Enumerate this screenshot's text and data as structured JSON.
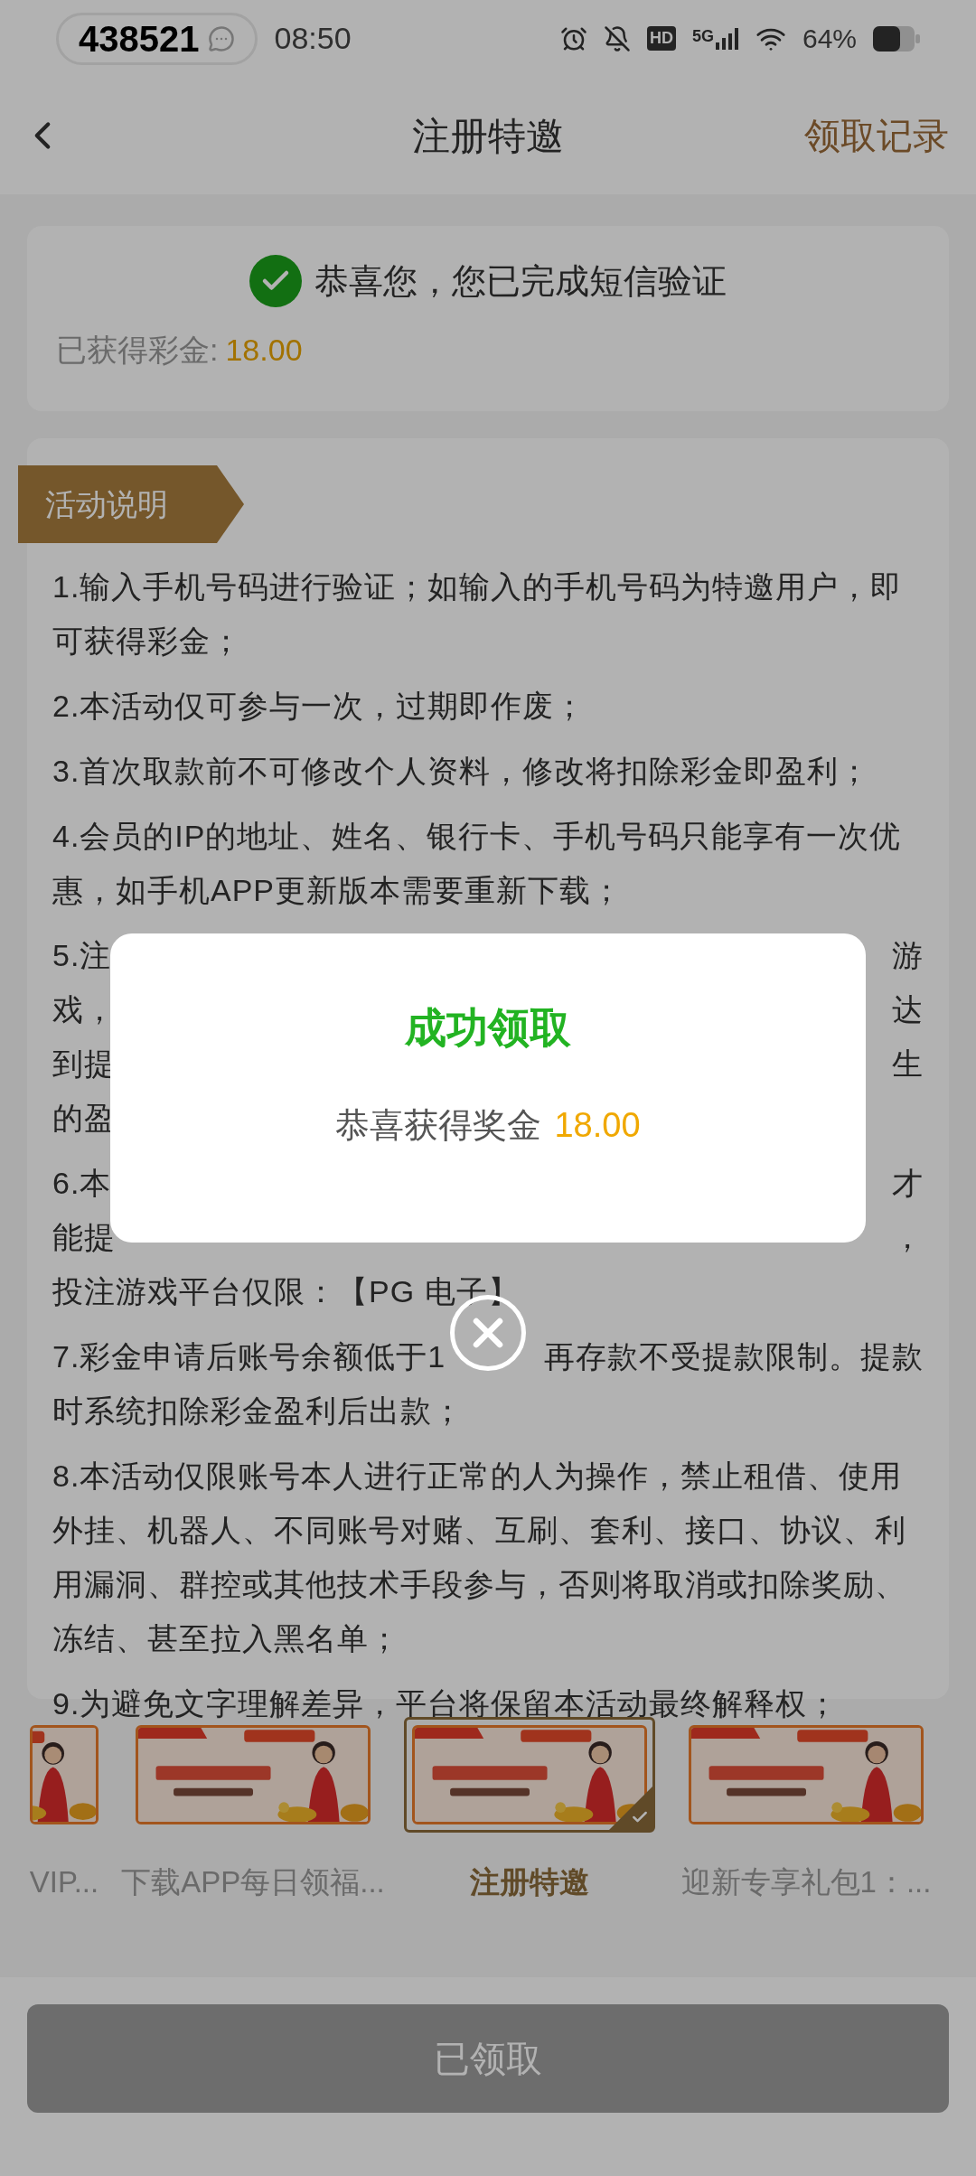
{
  "status_bar": {
    "badge": "438521",
    "time": "08:50",
    "hd": "HD",
    "network": "5G",
    "battery": "64%"
  },
  "header": {
    "title": "注册特邀",
    "action": "领取记录"
  },
  "verify_card": {
    "message": "恭喜您，您已完成短信验证",
    "earned_label": "已获得彩金:",
    "earned_value": "18.00"
  },
  "rules": {
    "tag": "活动说明",
    "items": [
      {
        "kind": "full",
        "text": "1.输入手机号码进行验证；如输入的手机号码为特邀用户，即可获得彩金；"
      },
      {
        "kind": "full",
        "text": "2.本活动仅可参与一次，过期即作废；"
      },
      {
        "kind": "full",
        "text": "3.首次取款前不可修改个人资料，修改将扣除彩金即盈利；"
      },
      {
        "kind": "full",
        "text": "4.会员的IP的地址、姓名、银行卡、手机号码只能享有一次优惠，如手机APP更新版本需要重新下载；"
      },
      {
        "kind": "partial",
        "lines": [
          {
            "left": "5.注",
            "right": "游"
          },
          {
            "left": "戏，",
            "right": "达"
          },
          {
            "left": "到提",
            "right": "生"
          },
          {
            "left": "的盈"
          }
        ]
      },
      {
        "kind": "partial",
        "lines": [
          {
            "left": "6.本",
            "right": "才"
          },
          {
            "left": "能提",
            "right": "，"
          },
          {
            "left": "投注游戏平台仅限：【PG 电子】"
          }
        ]
      },
      {
        "kind": "partial",
        "lines": [
          {
            "left": "7.彩金申请后账号余额低于1",
            "right": "再存款不受提款限制。提款"
          },
          {
            "left": "时系统扣除彩金盈利后出款；"
          }
        ]
      },
      {
        "kind": "full",
        "text": "8.本活动仅限账号本人进行正常的人为操作，禁止租借、使用外挂、机器人、不同账号对赌、互刷、套利、接口、协议、利用漏洞、群控或其他技术手段参与，否则将取消或扣除奖励、冻结、甚至拉入黑名单；"
      },
      {
        "kind": "full",
        "text": "9.为避免文字理解差异，平台将保留本活动最终解释权；"
      }
    ]
  },
  "promos": [
    {
      "label": "VIP...",
      "selected": false
    },
    {
      "label": "下载APP每日领福...",
      "selected": false
    },
    {
      "label": "注册特邀",
      "selected": true
    },
    {
      "label": "迎新专享礼包1：...",
      "selected": false
    }
  ],
  "claim_button": {
    "label": "已领取",
    "disabled": true
  },
  "dialog": {
    "title": "成功领取",
    "message": "恭喜获得奖金",
    "amount": "18.00"
  }
}
